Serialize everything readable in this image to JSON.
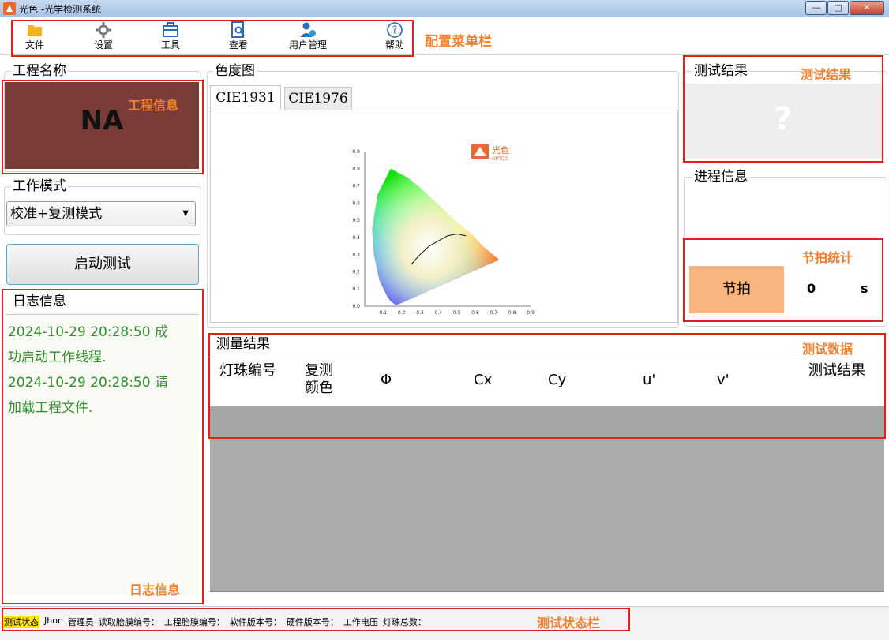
{
  "window": {
    "title": "光色 -光学检测系统",
    "controls": [
      "—",
      "□",
      "✕"
    ]
  },
  "toolbar": {
    "items": [
      {
        "label": "文件",
        "icon": "folder-icon"
      },
      {
        "label": "设置",
        "icon": "gear-icon"
      },
      {
        "label": "工具",
        "icon": "toolbox-icon"
      },
      {
        "label": "查看",
        "icon": "view-document-icon"
      },
      {
        "label": "用户管理",
        "icon": "user-manage-icon"
      },
      {
        "label": "帮助",
        "icon": "help-icon"
      }
    ],
    "note": "配置菜单栏"
  },
  "project": {
    "title": "工程名称",
    "value": "NA",
    "note": "工程信息"
  },
  "work_mode": {
    "title": "工作模式",
    "selected": "校准+复测模式"
  },
  "start_button": {
    "label": "启动测试"
  },
  "log": {
    "title": "日志信息",
    "lines": [
      "2024-10-29 20:28:50 成",
      "功启动工作线程.",
      "2024-10-29 20:28:50 请",
      "加载工程文件."
    ],
    "note": "日志信息"
  },
  "chromaticity": {
    "title": "色度图",
    "tabs": [
      "CIE1931",
      "CIE1976"
    ],
    "active_tab": "CIE1931",
    "logo_text": "光色",
    "logo_sub": "OPTCO"
  },
  "chart_data": {
    "type": "scatter",
    "title": "",
    "xlabel": "",
    "ylabel": "",
    "xlim": [
      0.0,
      0.9
    ],
    "ylim": [
      0.0,
      0.9
    ],
    "x_ticks": [
      "0.1",
      "0.2",
      "0.3",
      "0.4",
      "0.5",
      "0.6",
      "0.7",
      "0.8",
      "0.9"
    ],
    "y_ticks": [
      "0.0",
      "0.1",
      "0.2",
      "0.3",
      "0.4",
      "0.5",
      "0.6",
      "0.7",
      "0.8",
      "0.9"
    ],
    "series": [
      {
        "name": "",
        "x": [
          0.17,
          0.14,
          0.12,
          0.08,
          0.05,
          0.04,
          0.07,
          0.14,
          0.23,
          0.3,
          0.37,
          0.44,
          0.51,
          0.58,
          0.64,
          0.73,
          0.17
        ],
        "y": [
          0.005,
          0.03,
          0.06,
          0.15,
          0.3,
          0.45,
          0.65,
          0.8,
          0.75,
          0.69,
          0.62,
          0.55,
          0.48,
          0.42,
          0.35,
          0.27,
          0.005
        ]
      },
      {
        "name": "",
        "x": [
          0.25,
          0.3,
          0.35,
          0.4,
          0.45,
          0.5,
          0.55
        ],
        "y": [
          0.24,
          0.3,
          0.35,
          0.38,
          0.41,
          0.42,
          0.41
        ]
      }
    ]
  },
  "test_result": {
    "title": "测试结果",
    "value": "?",
    "note": "测试结果"
  },
  "progress": {
    "title": "进程信息"
  },
  "beat": {
    "note": "节拍统计",
    "label": "节拍",
    "value": "0",
    "unit": "s"
  },
  "measure": {
    "title": "测量结果",
    "note": "测试数据",
    "columns": [
      "灯珠编号",
      "复测颜色",
      "Φ",
      "Cx",
      "Cy",
      "u'",
      "v'",
      "测试结果"
    ],
    "rows": []
  },
  "statusbar": {
    "items": [
      "测试状态",
      "Jhon",
      "管理员",
      "读取胎膜编号：",
      "工程胎膜编号：",
      "软件版本号：",
      "硬件版本号：",
      "工作电压",
      "灯珠总数："
    ],
    "note": "测试状态栏"
  }
}
